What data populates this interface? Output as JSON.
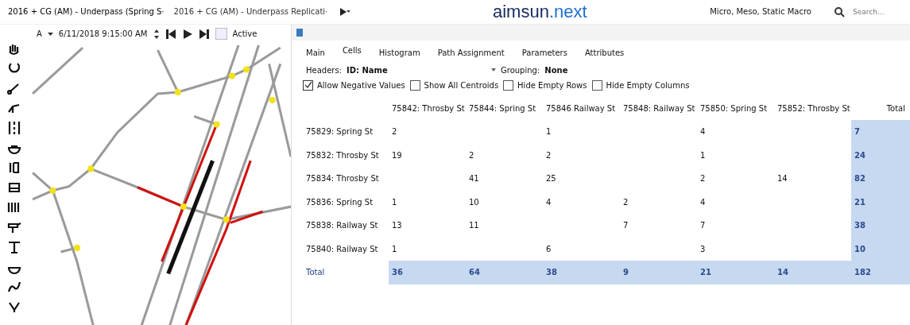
{
  "window_tabs": [
    {
      "label": "2016 + CG (AM) - Underpass (Spring S·",
      "selected": true
    },
    {
      "label": "2016 + CG (AM) - Underpass Replicati·",
      "selected": false
    }
  ],
  "logo": {
    "main": "aimsun",
    "accent": ".next"
  },
  "mode": "Micro, Meso, Static Macro",
  "search": {
    "placeholder": "Search..."
  },
  "playback": {
    "scenario": "A",
    "datetime": "6/11/2018 9:15:00 AM",
    "active": {
      "label": "Active",
      "checked": false
    }
  },
  "matrix": {
    "tabs": [
      {
        "label": "Main",
        "selected": false
      },
      {
        "label": "Cells",
        "selected": true
      },
      {
        "label": "Histogram",
        "selected": false
      },
      {
        "label": "Path Assignment",
        "selected": false
      },
      {
        "label": "Parameters",
        "selected": false
      },
      {
        "label": "Attributes",
        "selected": false
      }
    ],
    "headers": {
      "label": "Headers:",
      "value": "ID: Name"
    },
    "grouping": {
      "label": "Grouping:",
      "value": "None"
    },
    "options": [
      {
        "label": "Allow Negative Values",
        "checked": true
      },
      {
        "label": "Show All Centroids",
        "checked": false
      },
      {
        "label": "Hide Empty Rows",
        "checked": false
      },
      {
        "label": "Hide Empty Columns",
        "checked": false
      }
    ],
    "columns": [
      "75842: Throsby St",
      "75844: Spring St",
      "75846 Railway St",
      "75848: Railway St",
      "75850: Spring St",
      "75852: Throsby St"
    ],
    "total_heading": "Total",
    "rows": [
      {
        "name": "75829: Spring St",
        "cells": [
          "2",
          null,
          "1",
          null,
          "4",
          null
        ],
        "total": "7"
      },
      {
        "name": "75832: Throsby St",
        "cells": [
          "19",
          "2",
          "2",
          null,
          "1",
          null
        ],
        "total": "24"
      },
      {
        "name": "75834: Throsby St",
        "cells": [
          null,
          "41",
          "25",
          null,
          "2",
          "14"
        ],
        "total": "82"
      },
      {
        "name": "75836: Spring St",
        "cells": [
          "1",
          "10",
          "4",
          "2",
          "4",
          null
        ],
        "total": "21"
      },
      {
        "name": "75838: Railway St",
        "cells": [
          "13",
          "11",
          null,
          "7",
          "7",
          null
        ],
        "total": "38"
      },
      {
        "name": "75840: Railway St",
        "cells": [
          "1",
          null,
          "6",
          null,
          "3",
          null
        ],
        "total": "10"
      }
    ],
    "totals": {
      "label": "Total",
      "cells": [
        "36",
        "64",
        "38",
        "9",
        "21",
        "14"
      ],
      "total": "182"
    }
  }
}
